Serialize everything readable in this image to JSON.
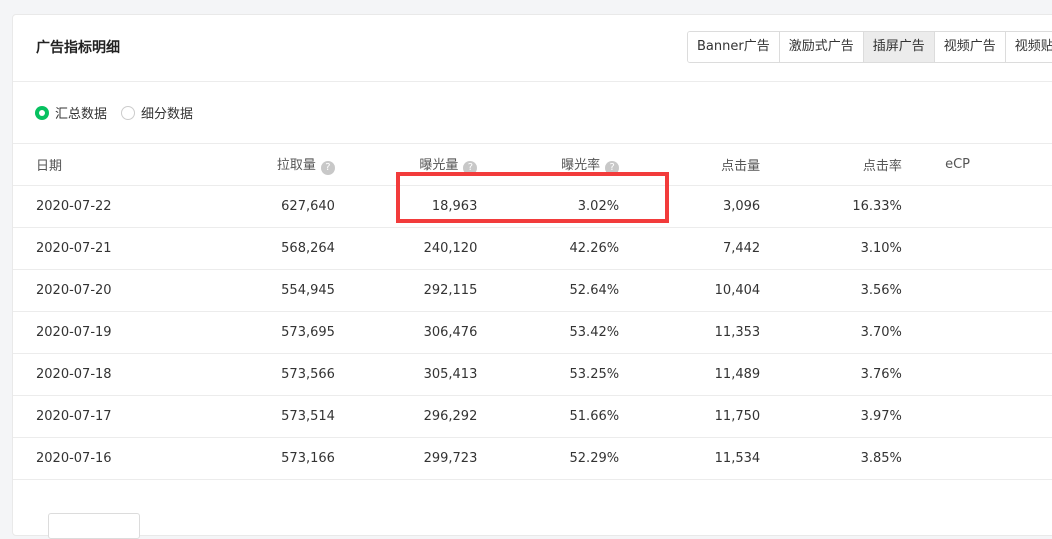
{
  "panel": {
    "title": "广告指标明细",
    "tabs": [
      {
        "label": "Banner广告",
        "active": false
      },
      {
        "label": "激励式广告",
        "active": false
      },
      {
        "label": "插屏广告",
        "active": true
      },
      {
        "label": "视频广告",
        "active": false
      },
      {
        "label": "视频贴",
        "active": false
      }
    ],
    "radios": [
      {
        "label": "汇总数据",
        "checked": true
      },
      {
        "label": "细分数据",
        "checked": false
      }
    ]
  },
  "table": {
    "headers": [
      "日期",
      "拉取量",
      "曝光量",
      "曝光率",
      "点击量",
      "点击率",
      "eCP"
    ],
    "rows": [
      [
        "2020-07-22",
        "627,640",
        "18,963",
        "3.02%",
        "3,096",
        "16.33%"
      ],
      [
        "2020-07-21",
        "568,264",
        "240,120",
        "42.26%",
        "7,442",
        "3.10%"
      ],
      [
        "2020-07-20",
        "554,945",
        "292,115",
        "52.64%",
        "10,404",
        "3.56%"
      ],
      [
        "2020-07-19",
        "573,695",
        "306,476",
        "53.42%",
        "11,353",
        "3.70%"
      ],
      [
        "2020-07-18",
        "573,566",
        "305,413",
        "53.25%",
        "11,489",
        "3.76%"
      ],
      [
        "2020-07-17",
        "573,514",
        "296,292",
        "51.66%",
        "11,750",
        "3.97%"
      ],
      [
        "2020-07-16",
        "573,166",
        "299,723",
        "52.29%",
        "11,534",
        "3.85%"
      ]
    ]
  },
  "colors": {
    "accent": "#07c160",
    "highlight": "#f23b3b"
  }
}
